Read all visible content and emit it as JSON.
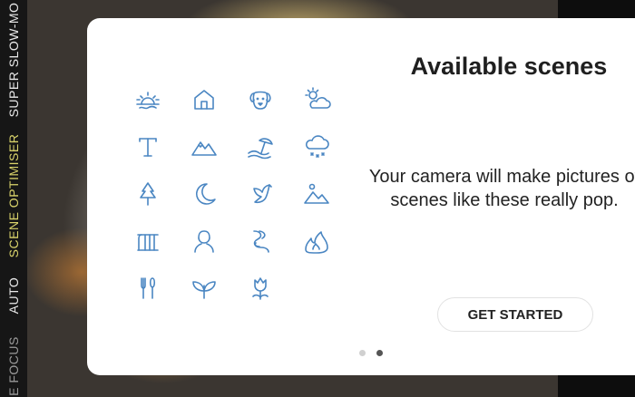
{
  "camera_modes": [
    {
      "label": "SUPER SLOW-MO",
      "state": "normal"
    },
    {
      "label": "SCENE OPTIMISER",
      "state": "active"
    },
    {
      "label": "AUTO",
      "state": "normal"
    },
    {
      "label": "E FOCUS",
      "state": "faded"
    }
  ],
  "dialog": {
    "title": "Available scenes",
    "description": "Your camera will make pictures of scenes like these really pop.",
    "button_label": "GET STARTED",
    "page_count": 2,
    "current_page": 2
  },
  "scene_icons": [
    "sunrise-icon",
    "home-icon",
    "dog-icon",
    "partly-cloudy-icon",
    "text-icon",
    "mountain-icon",
    "beach-icon",
    "snow-icon",
    "tree-icon",
    "night-icon",
    "bird-icon",
    "landscape-icon",
    "waterfall-icon",
    "portrait-icon",
    "street-icon",
    "fire-icon",
    "food-icon",
    "plant-icon",
    "flower-icon"
  ],
  "colors": {
    "icon": "#4a86c2",
    "active_mode": "#d8d26a"
  }
}
